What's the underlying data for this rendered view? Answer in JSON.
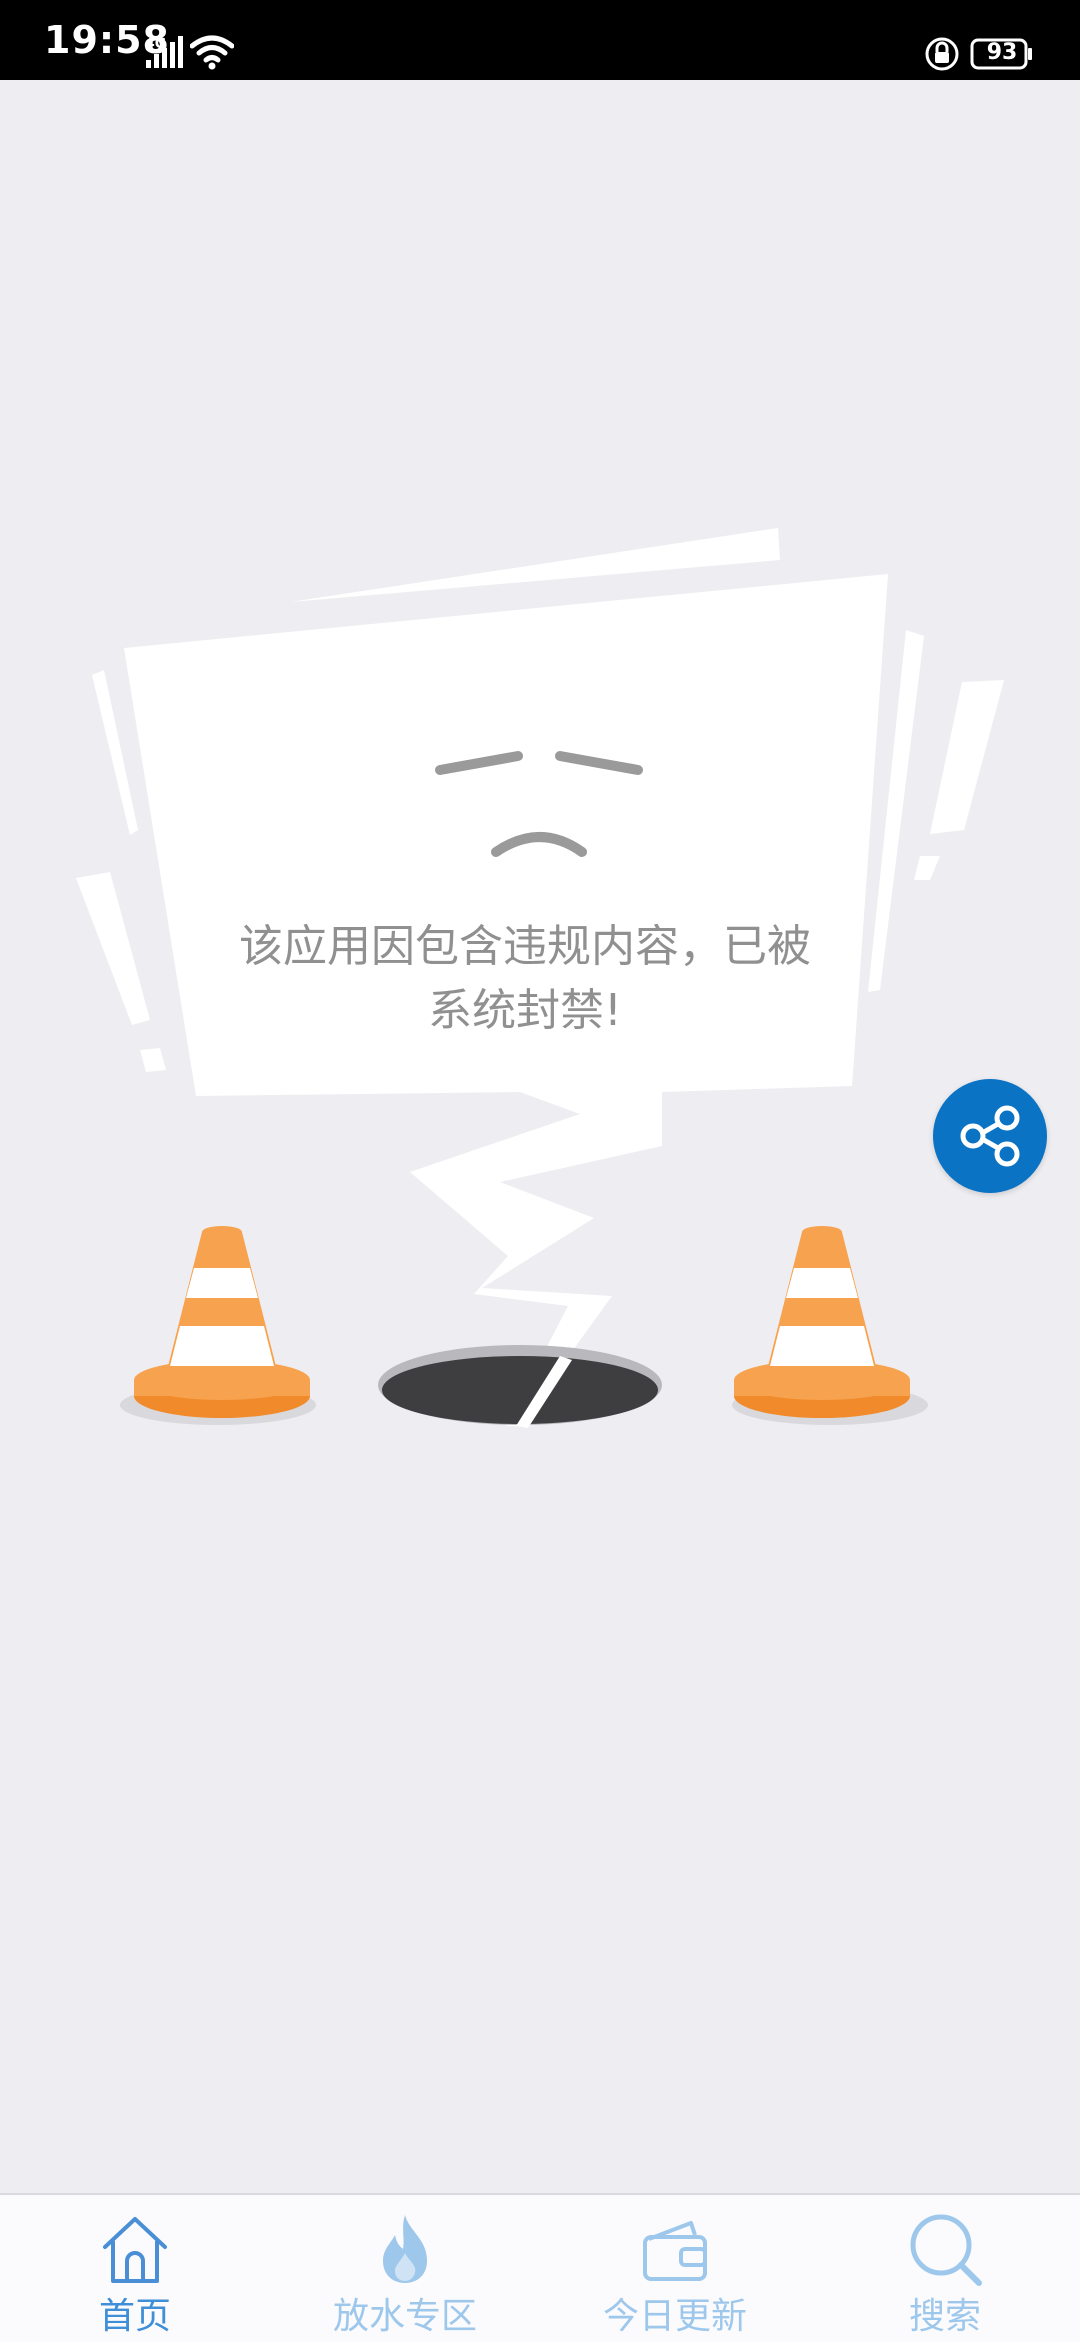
{
  "status_bar": {
    "time": "19:58",
    "network": "4G",
    "battery": "93"
  },
  "error": {
    "message_line1": "该应用因包含违规内容，已被",
    "message_line2": "系统封禁!"
  },
  "share_button": {
    "icon": "share-icon",
    "color": "#0a73c4"
  },
  "tabbar": {
    "active_color": "#3f8fd8",
    "inactive_color": "#9ec7ec",
    "tabs": [
      {
        "label": "首页",
        "icon": "home-icon",
        "active": true
      },
      {
        "label": "放水专区",
        "icon": "flame-icon",
        "active": false
      },
      {
        "label": "今日更新",
        "icon": "wallet-icon",
        "active": false
      },
      {
        "label": "搜索",
        "icon": "search-icon",
        "active": false
      }
    ]
  }
}
